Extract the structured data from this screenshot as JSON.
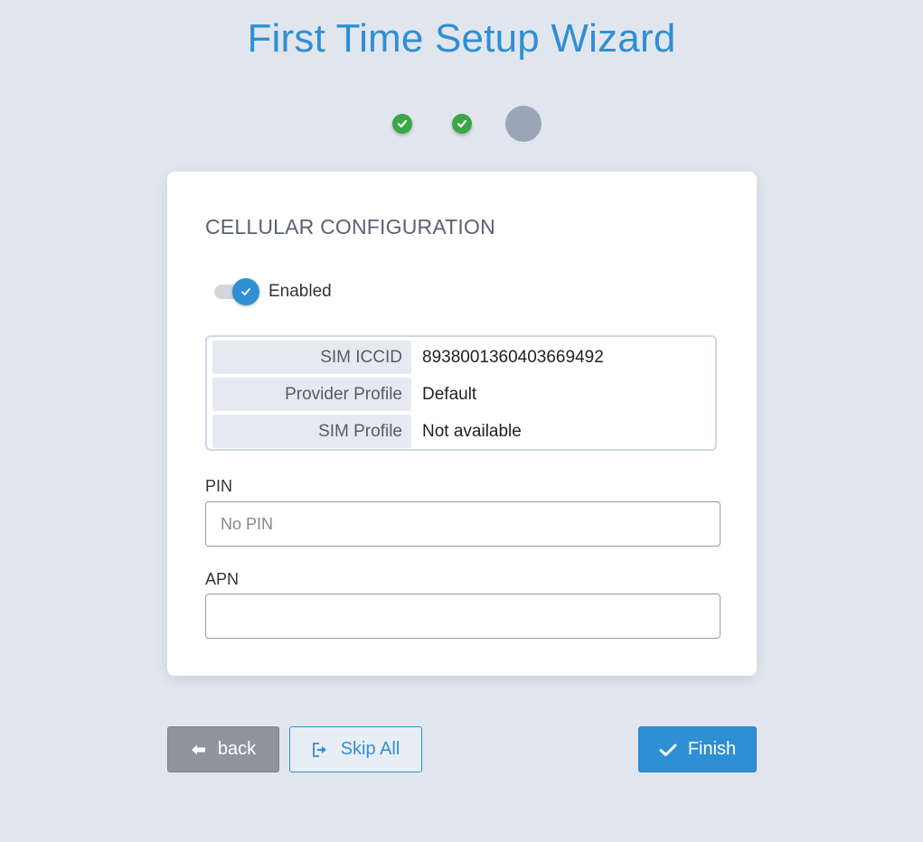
{
  "header": {
    "title": "First Time Setup Wizard"
  },
  "steps": [
    {
      "state": "done",
      "icon": "check-icon"
    },
    {
      "state": "done",
      "icon": "check-icon"
    },
    {
      "state": "current"
    }
  ],
  "card": {
    "section_title": "CELLULAR CONFIGURATION",
    "toggle": {
      "label": "Enabled",
      "checked": true
    },
    "info": [
      {
        "key": "SIM ICCID",
        "value": "8938001360403669492"
      },
      {
        "key": "Provider Profile",
        "value": "Default"
      },
      {
        "key": "SIM Profile",
        "value": "Not available"
      }
    ],
    "pin": {
      "label": "PIN",
      "placeholder": "No PIN",
      "value": ""
    },
    "apn": {
      "label": "APN",
      "placeholder": "",
      "value": ""
    }
  },
  "buttons": {
    "back": "back",
    "skip_all": "Skip All",
    "finish": "Finish"
  },
  "colors": {
    "accent": "#2f8fd3",
    "success": "#3aa645",
    "background": "#e1e6ee"
  }
}
